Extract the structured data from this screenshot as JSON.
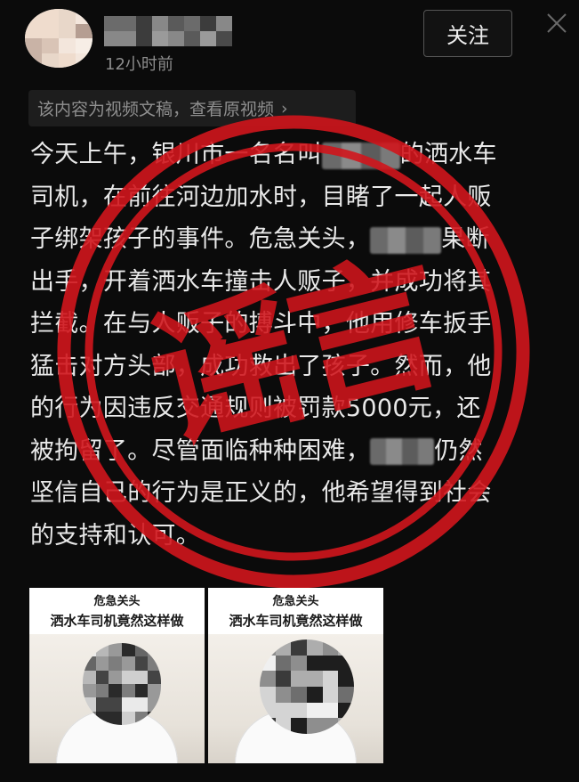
{
  "header": {
    "timestamp": "12小时前",
    "follow_label": "关注"
  },
  "video_bar": {
    "label": "该内容为视频文稿，查看原视频",
    "chevron": "›"
  },
  "article": {
    "lines": [
      [
        "今天上午，银川市一名名叫",
        "",
        "的洒水车"
      ],
      [
        "司机，在前往河边加水时，目睹了一起人贩"
      ],
      [
        "子绑架孩子的事件。危急关头，",
        "",
        "果断"
      ],
      [
        "出手，开着洒水车撞击人贩子，并成功将其"
      ],
      [
        "拦截。在与人贩子的搏斗中，他用修车扳手"
      ],
      [
        "猛击对方头部，成功救出了孩子。然而，他"
      ],
      [
        "的行为因违反交通规则被罚款5000元，还"
      ],
      [
        "被拘留了。尽管面临种种困难，",
        "",
        "仍然"
      ],
      [
        "坚信自己的行为是正义的，他希望得到社会"
      ],
      [
        "的支持和认可。"
      ]
    ]
  },
  "stamp": {
    "text": "谣言",
    "color": "#d0151c"
  },
  "thumbnails": [
    {
      "line1": "危急关头",
      "line2": "洒水车司机竟然这样做"
    },
    {
      "line1": "危急关头",
      "line2": "洒水车司机竟然这样做"
    }
  ],
  "icons": {
    "close": "close-icon"
  }
}
